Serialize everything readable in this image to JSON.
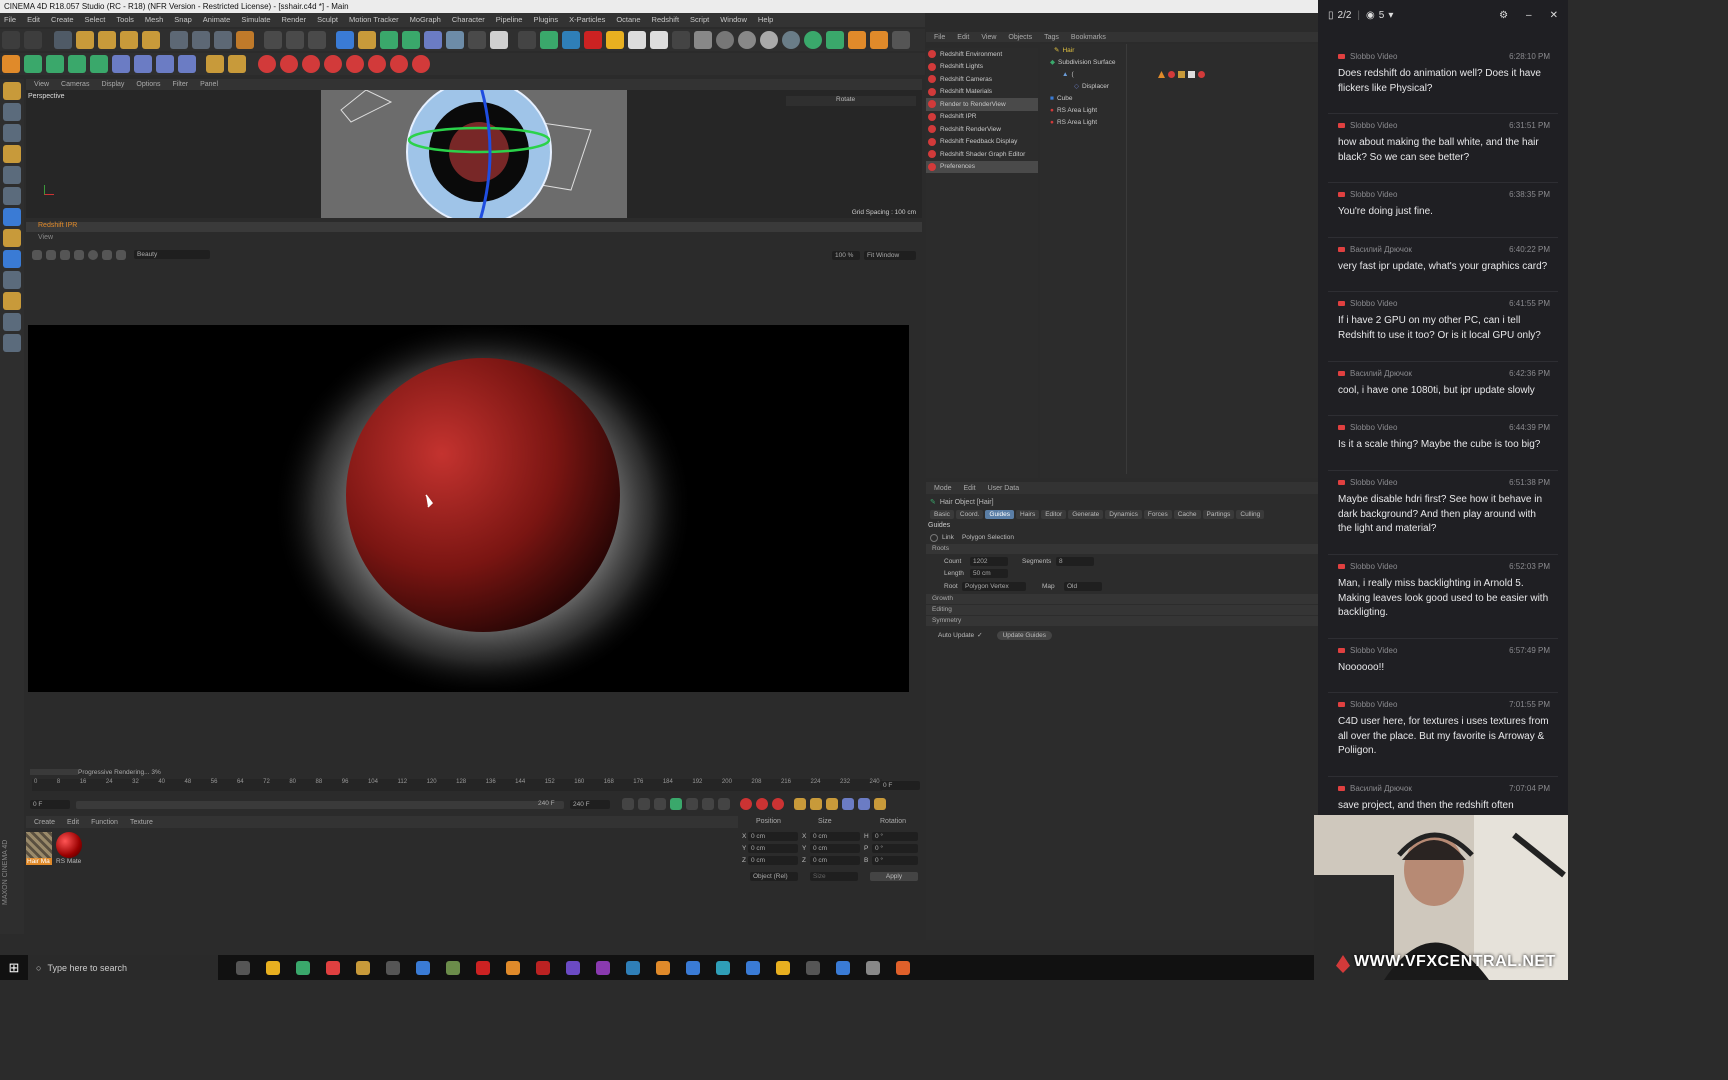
{
  "window": {
    "title": "CINEMA 4D R18.057 Studio (RC - R18) (NFR Version - Restricted License) - [sshair.c4d *] - Main"
  },
  "menubar": [
    "File",
    "Edit",
    "Create",
    "Select",
    "Tools",
    "Mesh",
    "Snap",
    "Animate",
    "Simulate",
    "Render",
    "Sculpt",
    "Motion Tracker",
    "MoGraph",
    "Character",
    "Pipeline",
    "Plugins",
    "X-Particles",
    "Octane",
    "Redshift",
    "Script",
    "Window",
    "Help"
  ],
  "viewport": {
    "menu": [
      "View",
      "Cameras",
      "Display",
      "Options",
      "Filter",
      "Panel"
    ],
    "label": "Perspective",
    "rotate_label": "Rotate",
    "grid_spacing": "Grid Spacing : 100 cm"
  },
  "ipr": {
    "title": "Redshift IPR",
    "view_menu": "View",
    "aov": "Beauty",
    "zoom": "100 %",
    "fit": "Fit Window"
  },
  "timeline": {
    "status": "Progressive Rendering... 3%",
    "ticks": [
      "0",
      "8",
      "16",
      "24",
      "32",
      "40",
      "48",
      "56",
      "64",
      "72",
      "80",
      "88",
      "96",
      "104",
      "112",
      "120",
      "128",
      "136",
      "144",
      "152",
      "160",
      "168",
      "176",
      "184",
      "192",
      "200",
      "208",
      "216",
      "224",
      "232",
      "240"
    ],
    "current_frame": "0 F",
    "start_frame": "0 F",
    "end_frame": "240 F",
    "end_frame_b": "240 F"
  },
  "materials": {
    "menu": [
      "Create",
      "Edit",
      "Function",
      "Texture"
    ],
    "items": [
      {
        "name": "Hair Ma"
      },
      {
        "name": "RS Mate"
      }
    ]
  },
  "coords": {
    "headers": [
      "Position",
      "Size",
      "Rotation"
    ],
    "rows": [
      {
        "axis": "X",
        "pos": "0 cm",
        "saxis": "X",
        "size": "0 cm",
        "raxis": "H",
        "rot": "0 °"
      },
      {
        "axis": "Y",
        "pos": "0 cm",
        "saxis": "Y",
        "size": "0 cm",
        "raxis": "P",
        "rot": "0 °"
      },
      {
        "axis": "Z",
        "pos": "0 cm",
        "saxis": "Z",
        "size": "0 cm",
        "raxis": "B",
        "rot": "0 °"
      }
    ],
    "mode": "Object (Rel)",
    "size_mode": "Size",
    "apply": "Apply"
  },
  "objmgr_menu": [
    "File",
    "Edit",
    "View",
    "Objects",
    "Tags",
    "Bookmarks"
  ],
  "redshift_menu": [
    "Redshift Environment",
    "Redshift Lights",
    "Redshift Cameras",
    "Redshift Materials",
    "Render to RenderView",
    "Redshift IPR",
    "Redshift RenderView",
    "Redshift Feedback Display",
    "Redshift Shader Graph Editor",
    "Preferences"
  ],
  "objects": [
    "Hair",
    "Subdivision Surface",
    "(",
    "Displacer",
    "Cube",
    "RS Area Light",
    "RS Area Light"
  ],
  "attributes": {
    "menu": [
      "Mode",
      "Edit",
      "User Data"
    ],
    "object_title": "Hair Object [Hair]",
    "tabs": [
      "Basic",
      "Coord.",
      "Guides",
      "Hairs",
      "Editor",
      "Generate",
      "Dynamics",
      "Forces",
      "Cache",
      "Partings",
      "Culling"
    ],
    "section": "Guides",
    "link_label": "Link",
    "link_value": "Polygon Selection",
    "roots_label": "Roots",
    "count_label": "Count",
    "count_value": "1202",
    "segments_label": "Segments",
    "segments_value": "8",
    "length_label": "Length",
    "length_value": "50 cm",
    "root_label": "Root",
    "root_value": "Polygon Vertex",
    "map_label": "Map",
    "map_value": "Old",
    "groups": [
      "Growth",
      "Editing",
      "Symmetry"
    ],
    "auto_update_label": "Auto Update",
    "auto_update_check": "✓",
    "update_guides": "Update Guides"
  },
  "taskbar": {
    "search_placeholder": "Type here to search"
  },
  "chat": {
    "header_count": "2/2",
    "viewers": "5",
    "messages": [
      {
        "author": "Slobbo Video",
        "time": "6:28:10 PM",
        "text": "Does redshift do animation well? Does it have flickers like Physical?"
      },
      {
        "author": "Slobbo Video",
        "time": "6:31:51 PM",
        "text": "how about making the ball white, and the hair black? So we can see better?"
      },
      {
        "author": "Slobbo Video",
        "time": "6:38:35 PM",
        "text": "You're doing just fine."
      },
      {
        "author": "Василий Дрючок",
        "time": "6:40:22 PM",
        "text": "very fast ipr update, what's your graphics card?"
      },
      {
        "author": "Slobbo Video",
        "time": "6:41:55 PM",
        "text": "If i have 2 GPU on my other PC, can i tell Redshift to use it too? Or is it local GPU only?"
      },
      {
        "author": "Василий Дрючок",
        "time": "6:42:36 PM",
        "text": "cool, i have one 1080ti, but ipr update slowly"
      },
      {
        "author": "Slobbo Video",
        "time": "6:44:39 PM",
        "text": "Is it a scale thing? Maybe the cube is too big?"
      },
      {
        "author": "Slobbo Video",
        "time": "6:51:38 PM",
        "text": "Maybe disable hdri first? See how it behave in dark background? And then play around with the light and material?"
      },
      {
        "author": "Slobbo Video",
        "time": "6:52:03 PM",
        "text": "Man, i really miss backlighting in Arnold 5. Making leaves look good used to be easier with backligting."
      },
      {
        "author": "Slobbo Video",
        "time": "6:57:49 PM",
        "text": "Noooooo!!"
      },
      {
        "author": "Slobbo Video",
        "time": "7:01:55 PM",
        "text": "C4D user here, for textures i uses textures from all over the place. But my favorite is Arroway & Poliigon."
      },
      {
        "author": "Василий Дрючок",
        "time": "7:07:04 PM",
        "text": "save project, and then the redshift often"
      }
    ]
  },
  "watermark": "WWW.VFXCENTRAL.NET",
  "colors": {
    "accent_blue": "#5a7ea6",
    "redshift_red": "#d23a3a",
    "chat_bg": "#1f1f23",
    "ipr_orange": "#e08a2a"
  }
}
